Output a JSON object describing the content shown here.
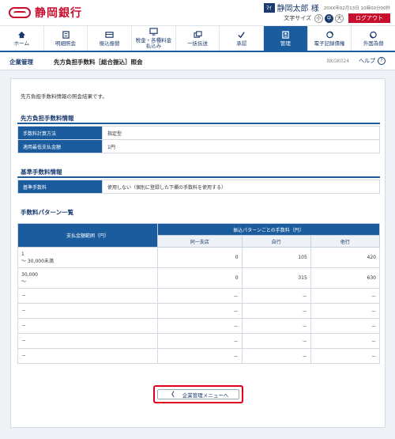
{
  "header": {
    "bank_name": "静岡銀行",
    "user_badge": "ﾏｲ",
    "user_name": "静岡太郎 様",
    "login_time": "20XX年02月13日 10時00分00秒",
    "text_size_label": "文字サイズ",
    "text_sizes": [
      "小",
      "中",
      "大"
    ],
    "logout_label": "ログアウト"
  },
  "nav": {
    "items": [
      {
        "label": "ホーム",
        "icon": "home-icon"
      },
      {
        "label": "明細照会",
        "icon": "statement-icon"
      },
      {
        "label": "振込振替",
        "icon": "transfer-icon"
      },
      {
        "label": "税金・各種料金\n払込み",
        "icon": "tax-payment-icon"
      },
      {
        "label": "一括伝送",
        "icon": "bulk-transfer-icon"
      },
      {
        "label": "承認",
        "icon": "approval-icon"
      },
      {
        "label": "管理",
        "icon": "management-icon"
      },
      {
        "label": "電子記録債権",
        "icon": "electronic-claim-icon"
      },
      {
        "label": "外国為替",
        "icon": "foreign-exchange-icon"
      }
    ],
    "active_index": 6
  },
  "title_bar": {
    "section": "企業管理",
    "title": "先方負担手数料［総合振込］照会",
    "screen_code": "BKGK024",
    "help_label": "ヘルプ",
    "help_symbol": "?"
  },
  "intro_text": "先方負担手数料情報の照会結果です。",
  "sender_fee_info": {
    "section_title": "先方負担手数料情報",
    "rows": [
      {
        "key": "手数料計算方法",
        "value": "指定型"
      },
      {
        "key": "適用最低支払金額",
        "value": "1円"
      }
    ]
  },
  "standard_fee_info": {
    "section_title": "基準手数料情報",
    "rows": [
      {
        "key": "基準手数料",
        "value": "使用しない（個別に登録した下欄の手数料を使用する）"
      }
    ]
  },
  "fee_pattern": {
    "section_title": "手数料パターン一覧",
    "header_range": "支払金額範囲（円）",
    "header_group": "振込パターンごとの手数料（円）",
    "sub_headers": [
      "同一支店",
      "自行",
      "他行"
    ],
    "rows": [
      {
        "range": [
          "1",
          "～ 30,000未満"
        ],
        "same_branch": "0",
        "own_bank": "105",
        "other_bank": "420"
      },
      {
        "range": [
          "30,000",
          "～"
        ],
        "same_branch": "0",
        "own_bank": "315",
        "other_bank": "630"
      },
      {
        "range": [
          "－"
        ],
        "same_branch": "－",
        "own_bank": "－",
        "other_bank": "－"
      },
      {
        "range": [
          "－"
        ],
        "same_branch": "－",
        "own_bank": "－",
        "other_bank": "－"
      },
      {
        "range": [
          "－"
        ],
        "same_branch": "－",
        "own_bank": "－",
        "other_bank": "－"
      },
      {
        "range": [
          "－"
        ],
        "same_branch": "－",
        "own_bank": "－",
        "other_bank": "－"
      },
      {
        "range": [
          "－"
        ],
        "same_branch": "－",
        "own_bank": "－",
        "other_bank": "－"
      }
    ]
  },
  "back_button": {
    "label": "企業管理メニューへ",
    "chevron": "〈"
  },
  "colors": {
    "brand_red": "#c8102e",
    "navy": "#1a3a6e",
    "table_blue": "#1a5c9e",
    "highlight_red": "#e0001b"
  }
}
